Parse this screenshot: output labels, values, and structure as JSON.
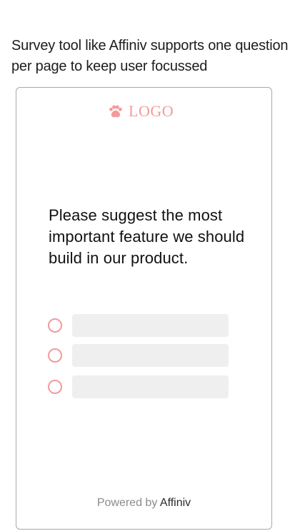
{
  "caption": "Survey tool like Affiniv supports one question per page to keep user focussed",
  "card": {
    "logo_text": "LOGO",
    "logo_icon": "paw-icon",
    "question": "Please suggest the most important feature we should build in our product.",
    "options": [
      {
        "label": ""
      },
      {
        "label": ""
      },
      {
        "label": ""
      }
    ],
    "footer_prefix": "Powered by",
    "footer_brand": "Affiniv"
  },
  "colors": {
    "accent": "#f29a9c",
    "option_fill": "#efefef",
    "border": "#a9a9a9"
  }
}
